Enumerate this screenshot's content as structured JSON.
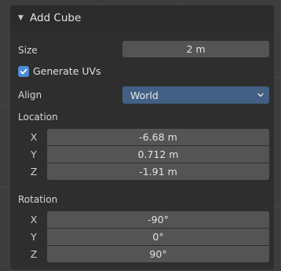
{
  "operator_panel": {
    "title": "Add Cube",
    "collapse_icon": "triangle-down-icon",
    "size": {
      "label": "Size",
      "value": "2 m"
    },
    "generate_uvs": {
      "label": "Generate UVs",
      "checked": true
    },
    "align": {
      "label": "Align",
      "value": "World"
    },
    "location": {
      "label": "Location",
      "x": {
        "axis": "X",
        "value": "-6.68 m"
      },
      "y": {
        "axis": "Y",
        "value": "0.712 m"
      },
      "z": {
        "axis": "Z",
        "value": "-1.91 m"
      }
    },
    "rotation": {
      "label": "Rotation",
      "x": {
        "axis": "X",
        "value": "-90°"
      },
      "y": {
        "axis": "Y",
        "value": "0°"
      },
      "z": {
        "axis": "Z",
        "value": "90°"
      }
    }
  },
  "colors": {
    "checkbox_accent": "#4c8cd6",
    "select_bg": "#425f84",
    "field_bg": "#545454",
    "panel_bg": "#2e2e2e"
  }
}
